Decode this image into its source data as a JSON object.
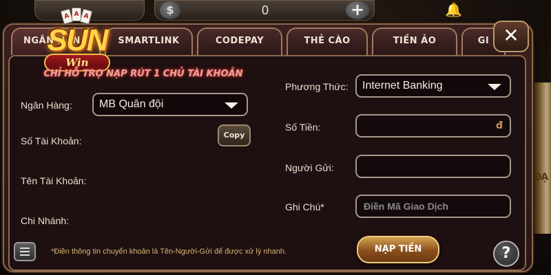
{
  "background": {
    "balance": "0",
    "currency_symbol": "$",
    "plus_label": "+",
    "side_text": "ĐẠ"
  },
  "logo": {
    "main": "SUN",
    "sub": "Win",
    "cards": [
      "A",
      "A",
      "A"
    ]
  },
  "tabs": [
    {
      "label": "NGÂN HÀNG",
      "active": true
    },
    {
      "label": "SMARTLINK",
      "active": false
    },
    {
      "label": "CODEPAY",
      "active": false
    },
    {
      "label": "THẺ CÀO",
      "active": false
    },
    {
      "label": "TIỀN ẢO",
      "active": false
    },
    {
      "label": "GI",
      "active": false
    }
  ],
  "close_label": "✕",
  "left_panel": {
    "notice": "CHỈ HỖ TRỢ NẠP RÚT 1 CHỦ TÀI KHOẢN",
    "bank_label": "Ngân Hàng:",
    "bank_value": "MB Quân đội",
    "account_number_label": "Số Tài Khoản:",
    "copy_label": "Copy",
    "account_name_label": "Tên Tài Khoản:",
    "branch_label": "Chi Nhánh:"
  },
  "right_panel": {
    "method_label": "Phương Thức:",
    "method_value": "Internet Banking",
    "amount_label": "Số Tiền:",
    "amount_currency": "đ",
    "sender_label": "Người Gửi:",
    "note_label": "Ghi Chú*",
    "note_placeholder": "Điền Mã Giao Dịch"
  },
  "footer": {
    "note": "*Điền thông tin chuyển khoản là Tên-Người-Gửi để được xử lý nhanh.",
    "submit_label": "NẠP TIỀN",
    "help_label": "?"
  },
  "colors": {
    "accent_gold": "#d4a052",
    "border": "#8c6a4a",
    "notice_red": "#e9a09a"
  }
}
